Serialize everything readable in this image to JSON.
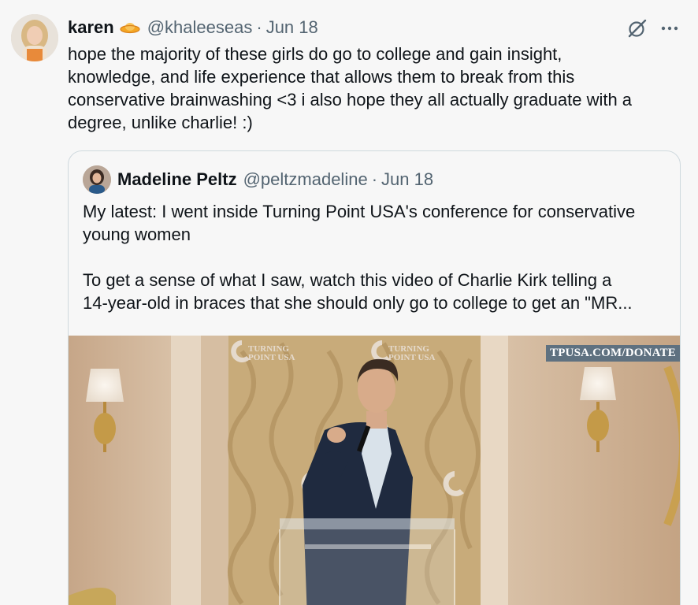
{
  "tweet": {
    "author_name": "karen",
    "handle": "@khaleeseas",
    "separator": "·",
    "date": "Jun 18",
    "text": "hope the majority of these girls do go to college and gain insight,\nknowledge, and life experience that allows them to break from this\nconservative brainwashing <3 i also hope they all actually graduate with a\ndegree, unlike charlie! :)"
  },
  "icons": {
    "name_emoji": "flying-saucer-icon",
    "grok": "grok-icon",
    "more": "more-icon"
  },
  "quote": {
    "author_name": "Madeline Peltz",
    "handle": "@peltzmadeline",
    "separator": "·",
    "date": "Jun 18",
    "text": "My latest: I went inside Turning Point USA's conference for conservative\nyoung women\n\nTo get a sense of what I saw, watch this video of Charlie Kirk telling a\n14-year-old in braces that she should only go to college to get an \"MR...",
    "media": {
      "watermark": "TPUSA.COM/DONATE",
      "backdrop_logo_line1": "TURNING",
      "backdrop_logo_line2": "POINT USA"
    }
  },
  "colors": {
    "background": "#f7f7f7",
    "text_primary": "#0f1419",
    "text_secondary": "#536471",
    "border": "#cfd9de",
    "emoji": "#f4a623"
  }
}
